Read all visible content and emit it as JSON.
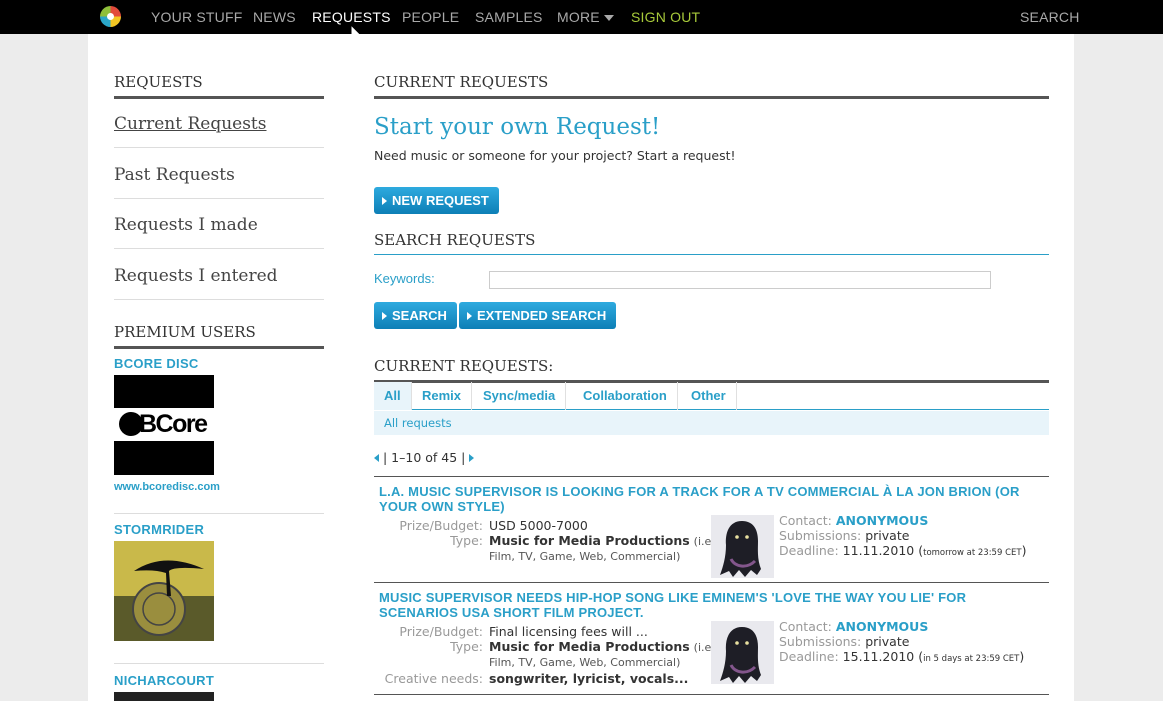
{
  "nav": {
    "items": [
      "YOUR STUFF",
      "NEWS",
      "REQUESTS",
      "PEOPLE",
      "SAMPLES",
      "MORE"
    ],
    "signout": "SIGN OUT",
    "search": "SEARCH"
  },
  "sidebar": {
    "heading": "REQUESTS",
    "links": [
      "Current Requests",
      "Past Requests",
      "Requests I made",
      "Requests I entered"
    ],
    "premium_heading": "PREMIUM USERS",
    "premium_users": [
      {
        "name": "BCORE DISC",
        "logo_text": "BCore",
        "url": "www.bcoredisc.com"
      },
      {
        "name": "STORMRIDER"
      },
      {
        "name": "NICHARCOURT"
      }
    ]
  },
  "main": {
    "heading": "CURRENT REQUESTS",
    "start_title": "Start your own Request!",
    "start_text": "Need music or someone for your project? Start a request!",
    "new_request_button": "NEW REQUEST",
    "search_heading": "SEARCH REQUESTS",
    "keywords_label": "Keywords:",
    "keywords_value": "",
    "search_button": "SEARCH",
    "extended_search_button": "EXTENDED SEARCH",
    "list_heading": "CURRENT REQUESTS:",
    "tabs": [
      "All",
      "Remix",
      "Sync/media",
      "Collaboration",
      "Other"
    ],
    "subtab": "All requests",
    "pager": "| 1–10 of 45 |"
  },
  "requests": [
    {
      "title": "L.A. MUSIC SUPERVISOR IS LOOKING FOR A TRACK FOR A TV COMMERCIAL À LA JON BRION (OR YOUR OWN STYLE)",
      "budget_label": "Prize/Budget:",
      "budget": "USD 5000-7000",
      "type_label": "Type:",
      "type": "Music for Media Productions",
      "type_note": "(i.e.",
      "type_note2": "Film, TV, Game, Web, Commercial)",
      "contact_label": "Contact:",
      "contact": "ANONYMOUS",
      "submissions_label": "Submissions:",
      "submissions": "private",
      "deadline_label": "Deadline:",
      "deadline": "11.11.2010",
      "deadline_note": "tomorrow at 23:59 CET"
    },
    {
      "title": "MUSIC SUPERVISOR NEEDS HIP-HOP SONG LIKE EMINEM'S 'LOVE THE WAY YOU LIE' FOR SCENARIOS USA SHORT FILM PROJECT.",
      "budget_label": "Prize/Budget:",
      "budget": "Final licensing fees will ...",
      "type_label": "Type:",
      "type": "Music for Media Productions",
      "type_note": "(i.e.",
      "type_note2": "Film, TV, Game, Web, Commercial)",
      "creative_label": "Creative needs:",
      "creative": "songwriter, lyricist, vocals...",
      "contact_label": "Contact:",
      "contact": "ANONYMOUS",
      "submissions_label": "Submissions:",
      "submissions": "private",
      "deadline_label": "Deadline:",
      "deadline": "15.11.2010",
      "deadline_note": "in 5 days at 23:59 CET"
    }
  ]
}
